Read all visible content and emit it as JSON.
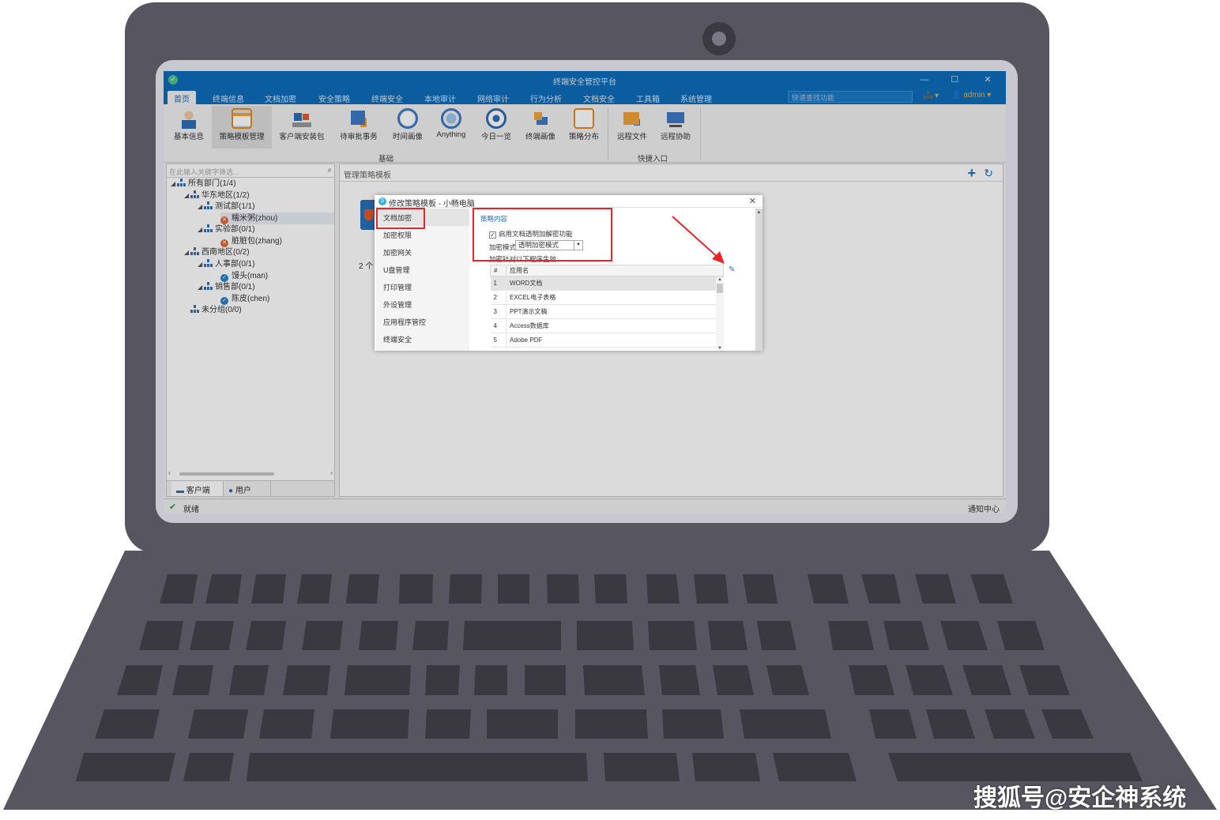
{
  "window": {
    "title": "终端安全管控平台",
    "controls": [
      "—",
      "☐",
      "✕"
    ]
  },
  "menu": {
    "items": [
      "首页",
      "终端信息",
      "文档加密",
      "安全策略",
      "终端安全",
      "本地审计",
      "网络审计",
      "行为分析",
      "文档安全",
      "工具箱",
      "系统管理"
    ],
    "active": "首页",
    "quick_search_placeholder": "快速查找功能",
    "org_menu": "▾",
    "user": "admin ▾"
  },
  "ribbon": {
    "buttons": [
      "基本信息",
      "策略模板管理",
      "客户端安装包",
      "待审批事务",
      "时间画像",
      "Anything",
      "今日一览",
      "终端画像",
      "策略分布",
      "远程文件",
      "远程协助"
    ],
    "groups": [
      "基础",
      "快捷入口"
    ]
  },
  "tree": {
    "search_placeholder": "在此输入关键字筛选...",
    "nodes": [
      "所有部门(1/4)",
      "华东地区(1/2)",
      "测试部(1/1)",
      "糯米粥(zhou)",
      "实验部(0/1)",
      "脏脏包(zhang)",
      "西南地区(0/2)",
      "人事部(0/1)",
      "馒头(man)",
      "销售部(0/1)",
      "陈皮(chen)",
      "未分组(0/0)"
    ]
  },
  "bottom_tabs": [
    "客户端",
    "用户"
  ],
  "main": {
    "header": "管理策略模板",
    "count_prefix": "2 个"
  },
  "status": {
    "text": "就绪",
    "notify": "通知中心"
  },
  "dialog": {
    "title": "修改策略模板 - 小畅电脑",
    "nav": [
      "文档加密",
      "加密权限",
      "加密网关",
      "U盘管理",
      "打印管理",
      "外设管理",
      "应用程序管控",
      "终端安全"
    ],
    "section_title": "策略内容",
    "enable_label": "启用文档透明加解密功能",
    "enable_checked": true,
    "mode_label": "加密模式",
    "mode_value": "透明加密模式",
    "apply_label": "加密针对以下程序生效:",
    "table_headers": [
      "#",
      "应用名"
    ],
    "apps": [
      {
        "num": "1",
        "name": "WORD文档"
      },
      {
        "num": "2",
        "name": "EXCEL电子表格"
      },
      {
        "num": "3",
        "name": "PPT演示文稿"
      },
      {
        "num": "4",
        "name": "Access数据库"
      },
      {
        "num": "5",
        "name": "Adobe PDF"
      }
    ]
  },
  "watermark": "搜狐号@安企神系统",
  "colors": {
    "titlebar": "#0e6dbb",
    "highlight": "#e8262a",
    "laptop_body": "#57555f",
    "bezel": "#c9c8d0"
  }
}
